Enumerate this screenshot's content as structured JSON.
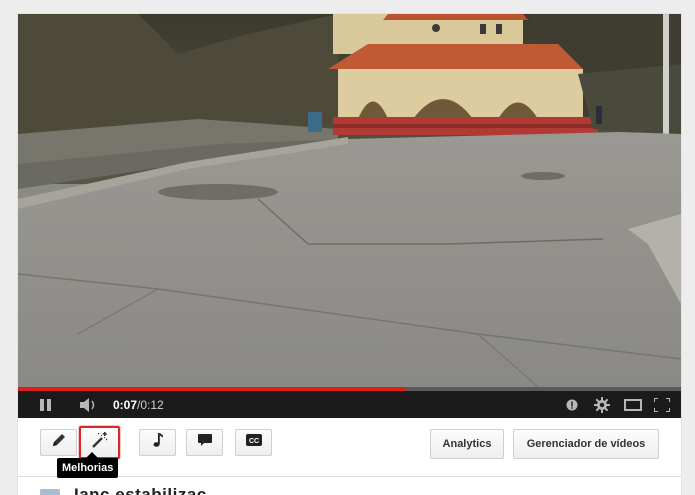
{
  "player": {
    "time_current": "0:07",
    "time_separator": " / ",
    "time_total": "0:12",
    "progress_fraction": 0.583,
    "accent_color": "#d9201c",
    "icons": [
      "pause-icon",
      "volume-icon",
      "annotations-icon",
      "gear-icon",
      "player-size-icon",
      "fullscreen-icon"
    ]
  },
  "toolbar": {
    "tools": [
      {
        "icon": "pencil-icon",
        "name": "edit"
      },
      {
        "icon": "magic-wand-icon",
        "name": "enhancements",
        "selected": true
      },
      {
        "icon": "music-note-icon",
        "name": "audio"
      },
      {
        "icon": "speech-bubble-icon",
        "name": "annotations"
      },
      {
        "icon": "cc-icon",
        "name": "captions"
      }
    ],
    "analytics_label": "Analytics",
    "video_manager_label": "Gerenciador de vídeos",
    "tooltip": "Melhorias"
  },
  "below": {
    "title_partial": "Ianc estabilizaç..."
  }
}
